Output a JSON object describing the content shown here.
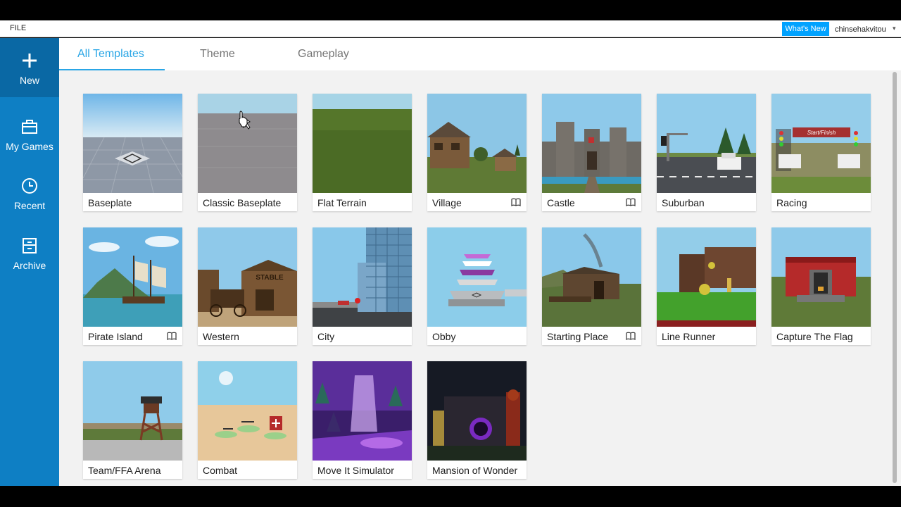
{
  "menubar": {
    "file_label": "FILE",
    "whats_new_label": "What's New",
    "username": "chinsehakvitou"
  },
  "sidebar": {
    "items": [
      {
        "label": "New"
      },
      {
        "label": "My Games"
      },
      {
        "label": "Recent"
      },
      {
        "label": "Archive"
      }
    ]
  },
  "tabs": [
    {
      "label": "All Templates"
    },
    {
      "label": "Theme"
    },
    {
      "label": "Gameplay"
    }
  ],
  "templates": [
    {
      "name": "Baseplate"
    },
    {
      "name": "Classic Baseplate"
    },
    {
      "name": "Flat Terrain"
    },
    {
      "name": "Village"
    },
    {
      "name": "Castle"
    },
    {
      "name": "Suburban"
    },
    {
      "name": "Racing"
    },
    {
      "name": "Pirate Island"
    },
    {
      "name": "Western"
    },
    {
      "name": "City"
    },
    {
      "name": "Obby"
    },
    {
      "name": "Starting Place"
    },
    {
      "name": "Line Runner"
    },
    {
      "name": "Capture The Flag"
    },
    {
      "name": "Team/FFA Arena"
    },
    {
      "name": "Combat"
    },
    {
      "name": "Move It Simulator"
    },
    {
      "name": "Mansion of Wonder"
    }
  ],
  "thumb_text": {
    "stable_sign": "STABLE",
    "racing_banner": "Start/Finish"
  },
  "colors": {
    "sidebar": "#0e7fc4",
    "sidebar_active": "#0a68a4",
    "accent": "#2aa6e6",
    "whats_new": "#00a2ff"
  }
}
